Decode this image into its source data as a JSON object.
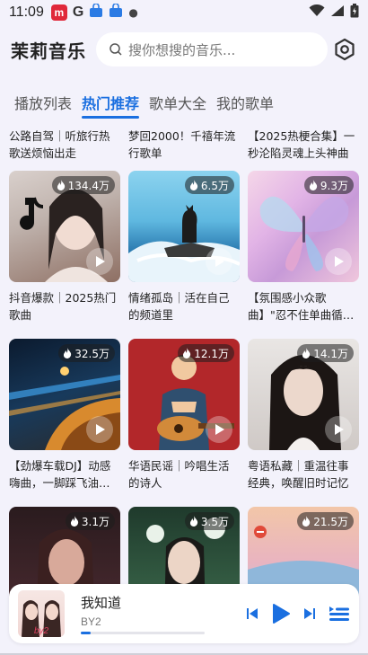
{
  "status_bar": {
    "time": "11:09",
    "app_icons": [
      "music-app-icon",
      "google-icon",
      "store-icon",
      "store-icon",
      "dot-icon"
    ],
    "right_icons": [
      "wifi-icon",
      "signal-icon",
      "battery-icon"
    ]
  },
  "header": {
    "app_title": "茉莉音乐",
    "search_placeholder": "搜你想搜的音乐..."
  },
  "tabs": [
    {
      "label": "播放列表",
      "active": false
    },
    {
      "label": "热门推荐",
      "active": true
    },
    {
      "label": "歌单大全",
      "active": false
    },
    {
      "label": "我的歌单",
      "active": false
    }
  ],
  "playlists": [
    {
      "title": "公路自驾｜听旅行热歌送烦恼出走",
      "plays": ""
    },
    {
      "title": "梦回2000！千禧年流行歌单",
      "plays": ""
    },
    {
      "title": "【2025热梗合集】一秒沦陷灵魂上头神曲",
      "plays": ""
    },
    {
      "title": "抖音爆款｜2025热门歌曲",
      "plays": "134.4万"
    },
    {
      "title": "情绪孤岛｜活在自己的频道里",
      "plays": "6.5万"
    },
    {
      "title": "【氛围感小众歌曲】\"忍不住单曲循…",
      "plays": "9.3万"
    },
    {
      "title": "【劲爆车载DJ】动感嗨曲，一脚踩飞油…",
      "plays": "32.5万"
    },
    {
      "title": "华语民谣｜吟唱生活的诗人",
      "plays": "12.1万"
    },
    {
      "title": "粤语私藏｜重温往事经典，唤醒旧时记忆",
      "plays": "14.1万"
    },
    {
      "title": "",
      "plays": "3.1万"
    },
    {
      "title": "",
      "plays": "3.5万"
    },
    {
      "title": "",
      "plays": "21.5万"
    }
  ],
  "player": {
    "song": "我知道",
    "artist": "BY2",
    "progress": 0.08
  },
  "colors": {
    "accent": "#1a6fe0",
    "background": "#f3f2fb"
  }
}
